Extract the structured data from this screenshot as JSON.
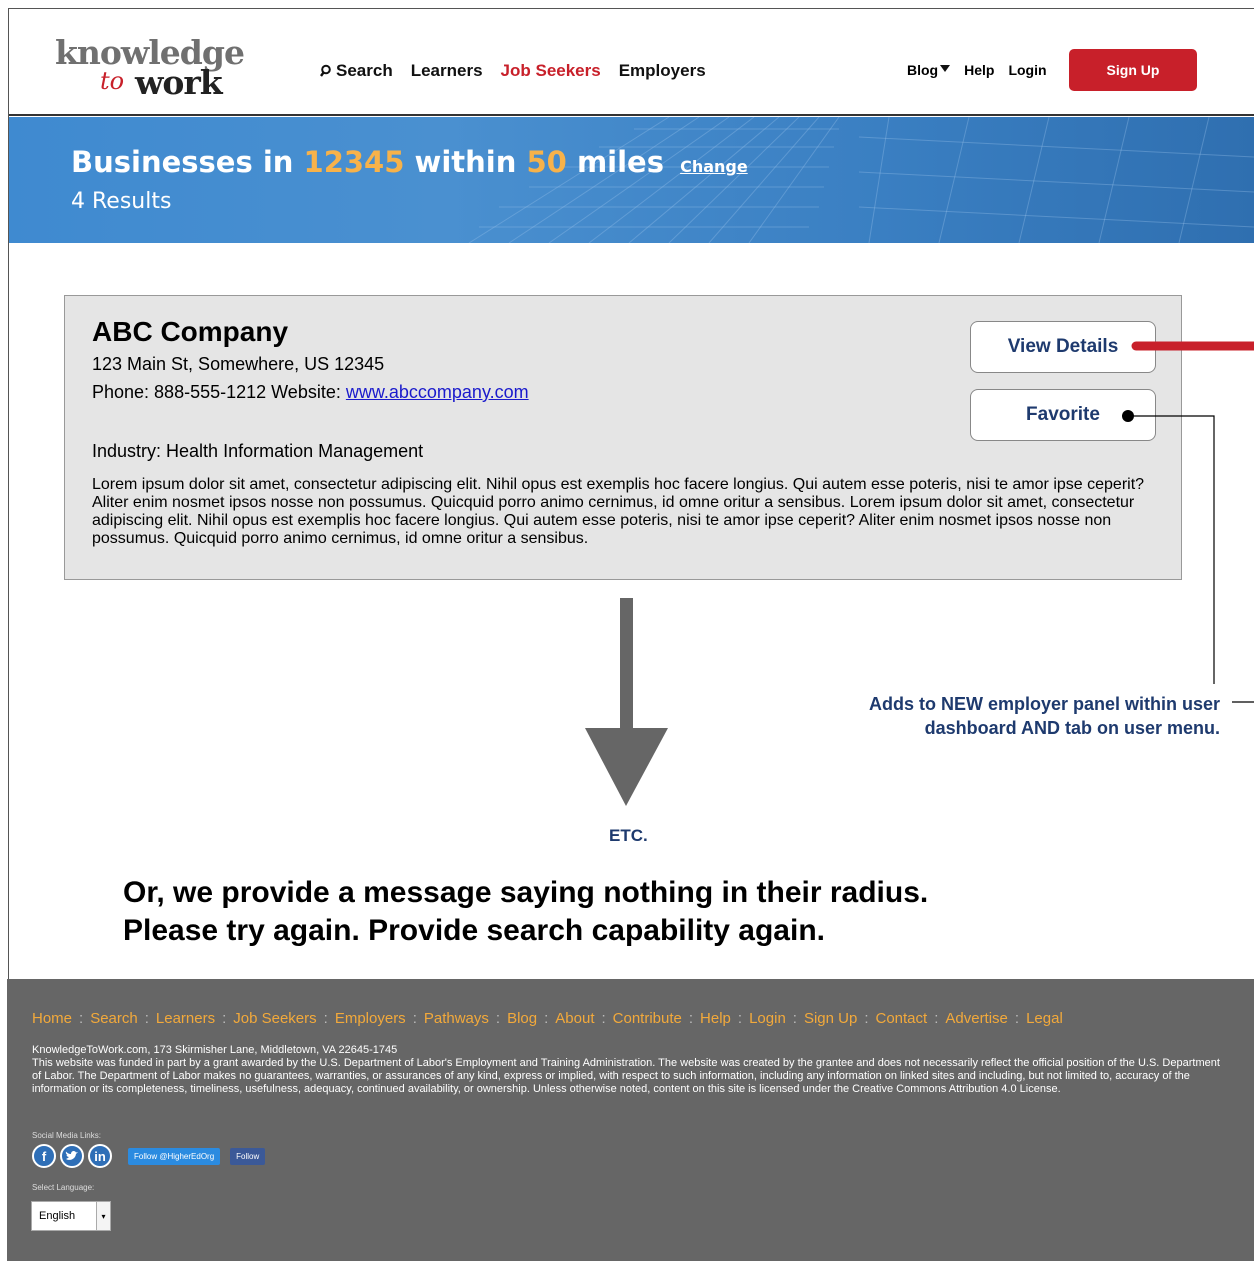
{
  "header": {
    "logo": {
      "line1": "knowledge",
      "line2": "to",
      "line3": "work"
    },
    "nav": {
      "search": "Search",
      "learners": "Learners",
      "job_seekers": "Job Seekers",
      "employers": "Employers"
    },
    "right": {
      "blog": "Blog",
      "help": "Help",
      "login": "Login",
      "signup": "Sign Up"
    }
  },
  "banner": {
    "prefix": "Businesses in",
    "zip": "12345",
    "within": "within",
    "miles_value": "50",
    "miles_word": "miles",
    "change": "Change",
    "results": "4 Results"
  },
  "result": {
    "company": "ABC Company",
    "address": "123 Main St, Somewhere, US 12345",
    "phone_label": "Phone: 888-555-1212 Website:",
    "website": "www.abccompany.com",
    "industry": "Industry: Health Information Management",
    "description": "Lorem ipsum dolor sit amet, consectetur adipiscing elit. Nihil opus est exemplis hoc facere longius. Qui autem esse poteris, nisi te amor ipse ceperit? Aliter enim nosmet ipsos nosse non possumus. Quicquid porro animo cernimus, id omne oritur a sensibus. Lorem ipsum dolor sit amet, consectetur adipiscing elit. Nihil opus est exemplis hoc facere longius. Qui autem esse poteris, nisi te amor ipse ceperit? Aliter enim nosmet ipsos nosse non possumus. Quicquid porro animo cernimus, id omne oritur a sensibus.",
    "view_details": "View Details",
    "favorite": "Favorite"
  },
  "annotations": {
    "favorite_note_line1": "Adds to NEW employer panel within user",
    "favorite_note_line2": "dashboard AND tab on user menu.",
    "etc": "ETC.",
    "message_line1": "Or, we provide a message saying nothing in their radius.",
    "message_line2": "Please try again. Provide search capability again."
  },
  "footer": {
    "links": [
      "Home",
      "Search",
      "Learners",
      "Job Seekers",
      "Employers",
      "Pathways",
      "Blog",
      "About",
      "Contribute",
      "Help",
      "Login",
      "Sign Up",
      "Contact",
      "Advertise",
      "Legal"
    ],
    "separator": ":",
    "address": "KnowledgeToWork.com, 173 Skirmisher Lane, Middletown, VA 22645-1745",
    "disclaimer": "This website was funded in part by a grant awarded by the U.S. Department of Labor's Employment and Training Administration. The website was created by the grantee and does not necessarily reflect the official position of the U.S. Department of Labor. The Department of Labor makes no guarantees, warranties, or assurances of any kind, express or implied, with respect to such information, including any information on linked sites and including, but not limited to, accuracy of the information or its completeness, timeliness, usefulness, adequacy, continued availability, or ownership. Unless otherwise noted, content on this site is licensed under the Creative Commons Attribution 4.0 License.",
    "social_label": "Social Media Links:",
    "twitter_follow": "Follow @HigherEdOrg",
    "facebook_follow": "Follow",
    "language_label": "Select Language:",
    "language_value": "English"
  },
  "colors": {
    "brand_red": "#c8202a",
    "navy": "#1e3a6e",
    "highlight": "#f7b24a",
    "footer_bg": "#666666",
    "footer_link": "#f2a93b"
  }
}
